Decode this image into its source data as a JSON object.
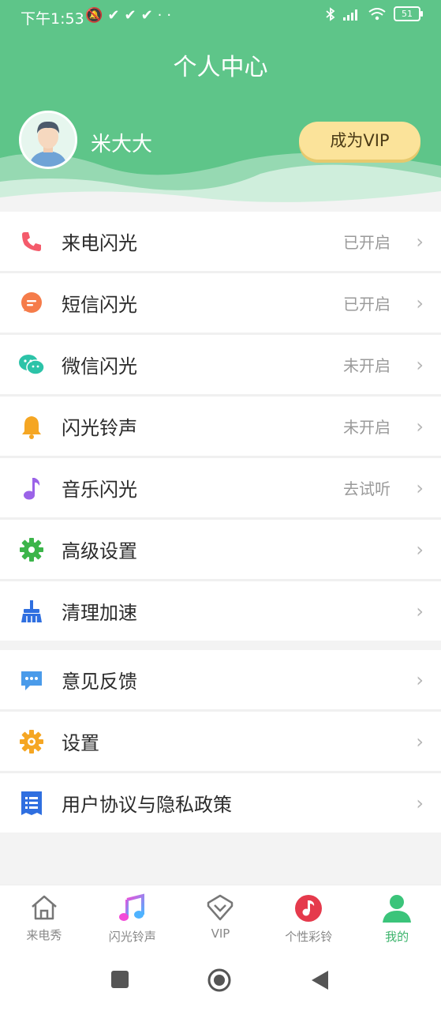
{
  "status_bar": {
    "time": "下午1:53",
    "battery": "51"
  },
  "header": {
    "title": "个人中心",
    "username": "米大大",
    "vip_button": "成为VIP"
  },
  "menu_group1": [
    {
      "label": "来电闪光",
      "status": "已开启",
      "icon": "phone-icon",
      "color": "#f45b6b"
    },
    {
      "label": "短信闪光",
      "status": "已开启",
      "icon": "message-icon",
      "color": "#f57c4a"
    },
    {
      "label": "微信闪光",
      "status": "未开启",
      "icon": "wechat-icon",
      "color": "#2cc3a8"
    },
    {
      "label": "闪光铃声",
      "status": "未开启",
      "icon": "bell-icon",
      "color": "#f5a623"
    },
    {
      "label": "音乐闪光",
      "status": "去试听",
      "icon": "music-note-icon",
      "color": "#9b63e8"
    },
    {
      "label": "高级设置",
      "status": "",
      "icon": "gear-icon",
      "color": "#3cb54a"
    },
    {
      "label": "清理加速",
      "status": "",
      "icon": "broom-icon",
      "color": "#2f6fe0"
    }
  ],
  "menu_group2": [
    {
      "label": "意见反馈",
      "icon": "feedback-icon",
      "color": "#4a9bea"
    },
    {
      "label": "设置",
      "icon": "settings-gear-icon",
      "color": "#f5a623"
    },
    {
      "label": "用户协议与隐私政策",
      "icon": "document-icon",
      "color": "#2f6fe0"
    }
  ],
  "tab_bar": [
    {
      "label": "来电秀",
      "icon": "home-icon"
    },
    {
      "label": "闪光铃声",
      "icon": "music-icon"
    },
    {
      "label": "VIP",
      "icon": "diamond-icon"
    },
    {
      "label": "个性彩铃",
      "icon": "ringtone-icon"
    },
    {
      "label": "我的",
      "icon": "profile-icon",
      "active": true
    }
  ],
  "chevron": "›"
}
